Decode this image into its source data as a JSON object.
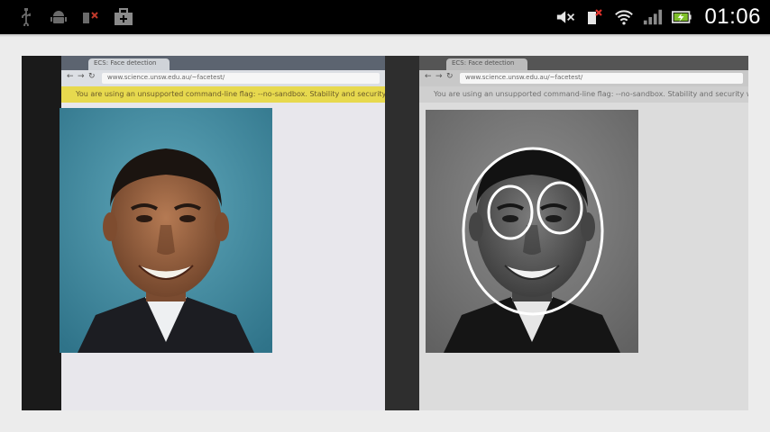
{
  "status_bar": {
    "left_icons": [
      "usb-icon",
      "android-debug-icon",
      "sim-missing-icon",
      "shopping-bag-icon"
    ],
    "right_icons": [
      "volume-muted-icon",
      "sim-error-icon",
      "wifi-icon",
      "signal-icon",
      "battery-charging-icon"
    ],
    "clock": "01:06"
  },
  "camera_view": {
    "left_panel": {
      "mode": "color",
      "browser_tab": "ECS: Face detection",
      "url": "www.science.unsw.edu.au/~facetest/",
      "warning": "You are using an unsupported command-line flag: --no-sandbox. Stability and security will suffer."
    },
    "right_panel": {
      "mode": "grayscale",
      "browser_tab": "ECS: Face detection",
      "url": "www.science.unsw.edu.au/~facetest/",
      "warning": "You are using an unsupported command-line flag: --no-sandbox. Stability and security will suffer."
    },
    "detections": [
      "face",
      "left-eye",
      "right-eye"
    ]
  },
  "colors": {
    "status_bar_bg": "#000000",
    "background": "#ececec",
    "warning_yellow": "#e7d94e",
    "photo_bg_blue": "#3f8aa0",
    "detection_stroke": "#ffffff"
  }
}
